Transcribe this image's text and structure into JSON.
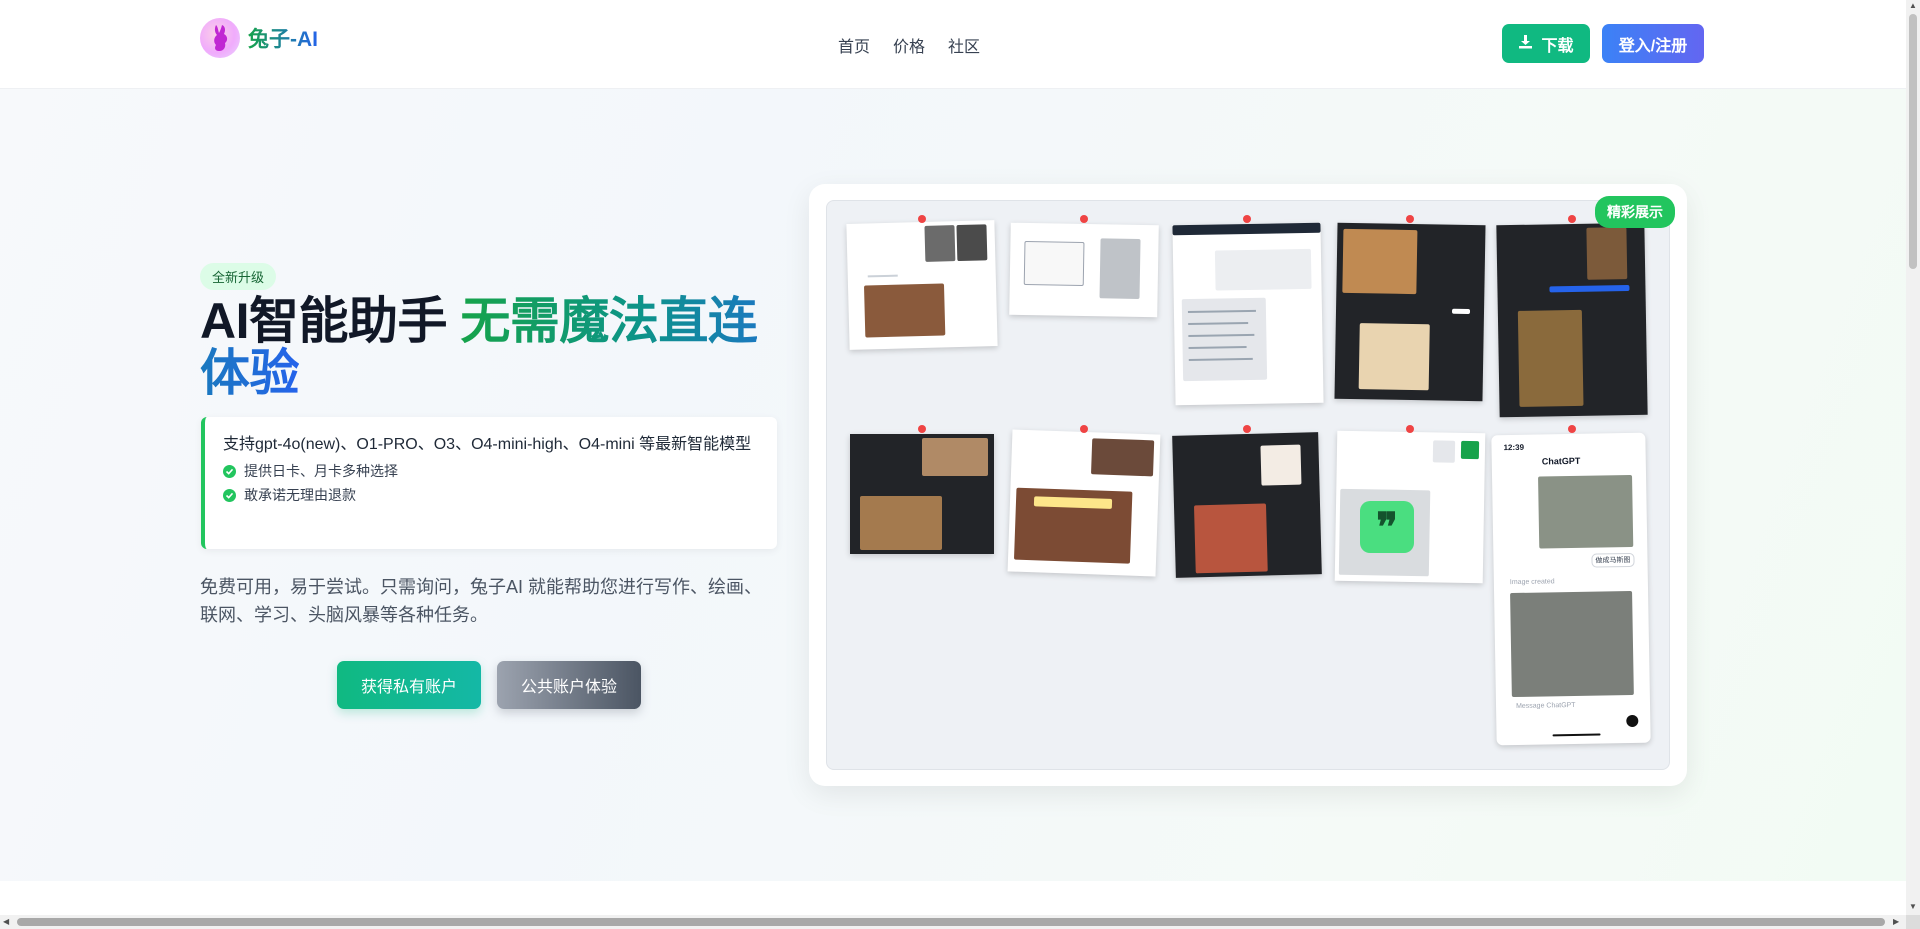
{
  "header": {
    "logo_text": "兔子-AI",
    "nav": [
      "首页",
      "价格",
      "社区"
    ],
    "download_label": "下载",
    "login_label": "登入/注册"
  },
  "hero": {
    "badge": "全新升级",
    "title_plain": "AI智能助手 ",
    "title_highlight": "无需魔法直连体验",
    "feature_main": "支持gpt-4o(new)、O1-PRO、O3、O4-mini-high、O4-mini 等最新智能模型",
    "feature_items": [
      "提供日卡、月卡多种选择",
      "敢承诺无理由退款"
    ],
    "description": "免费可用，易于尝试。只需询问，兔子AI 就能帮助您进行写作、绘画、联网、学习、头脑风暴等各种任务。",
    "btn_private": "获得私有账户",
    "btn_public": "公共账户体验"
  },
  "showcase": {
    "tag": "精彩展示",
    "phone_time": "12:39",
    "phone_title": "ChatGPT",
    "phone_chip": "做成马斯图",
    "phone_caption": "Image created",
    "phone_input_placeholder": "Message ChatGPT"
  },
  "colors": {
    "brand_green": "#10b981",
    "brand_blue": "#3b82f6",
    "pin_red": "#ef4444"
  }
}
